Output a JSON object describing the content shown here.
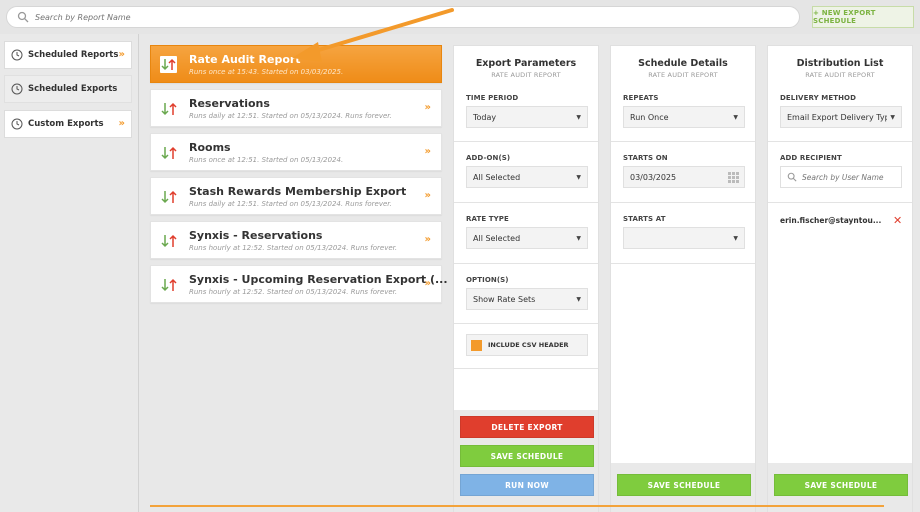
{
  "search": {
    "placeholder": "Search by Report Name"
  },
  "header": {
    "new_button": "+ NEW EXPORT SCHEDULE"
  },
  "sidebar": {
    "items": [
      {
        "label": "Scheduled Reports",
        "chevron": "»"
      },
      {
        "label": "Scheduled Exports"
      },
      {
        "label": "Custom Exports",
        "chevron": "»"
      }
    ]
  },
  "reports": [
    {
      "title": "Rate Audit Report",
      "subtitle": "Runs once at 15:43. Started on 03/03/2025."
    },
    {
      "title": "Reservations",
      "subtitle": "Runs daily at 12:51. Started on 05/13/2024. Runs forever.",
      "chevron": "»"
    },
    {
      "title": "Rooms",
      "subtitle": "Runs once at 12:51. Started on 05/13/2024.",
      "chevron": "»"
    },
    {
      "title": "Stash Rewards Membership Export",
      "subtitle": "Runs daily at 12:51. Started on 05/13/2024. Runs forever.",
      "chevron": "»"
    },
    {
      "title": "Synxis - Reservations",
      "subtitle": "Runs hourly at 12:52. Started on 05/13/2024. Runs forever.",
      "chevron": "»"
    },
    {
      "title": "Synxis - Upcoming Reservation Export (...",
      "subtitle": "Runs hourly at 12:52. Started on 05/13/2024. Runs forever.",
      "chevron": "»"
    }
  ],
  "export_params": {
    "title": "Export Parameters",
    "subtitle": "RATE AUDIT REPORT",
    "time_period_label": "TIME PERIOD",
    "time_period": "Today",
    "addons_label": "ADD-ON(S)",
    "addons": "All Selected",
    "rate_type_label": "RATE TYPE",
    "rate_type": "All Selected",
    "options_label": "OPTION(S)",
    "options": "Show Rate Sets",
    "csv_header": "INCLUDE CSV HEADER",
    "delete_button": "DELETE EXPORT",
    "save_button": "SAVE SCHEDULE",
    "run_button": "RUN NOW"
  },
  "schedule": {
    "title": "Schedule Details",
    "subtitle": "RATE AUDIT REPORT",
    "repeats_label": "REPEATS",
    "repeats": "Run Once",
    "starts_on_label": "STARTS ON",
    "starts_on": "03/03/2025",
    "starts_at_label": "STARTS AT",
    "starts_at": "",
    "save_button": "SAVE SCHEDULE"
  },
  "distribution": {
    "title": "Distribution List",
    "subtitle": "RATE AUDIT REPORT",
    "method_label": "DELIVERY METHOD",
    "method": "Email Export Delivery Type",
    "recipient_label": "ADD RECIPIENT",
    "recipient_placeholder": "Search by User Name",
    "recipients": [
      "erin.fischer@stayntou..."
    ],
    "save_button": "SAVE SCHEDULE"
  },
  "colors": {
    "accent": "#f39a2b",
    "green": "#7fcc3e",
    "red": "#e03e2d",
    "blue": "#7fb3e6"
  }
}
